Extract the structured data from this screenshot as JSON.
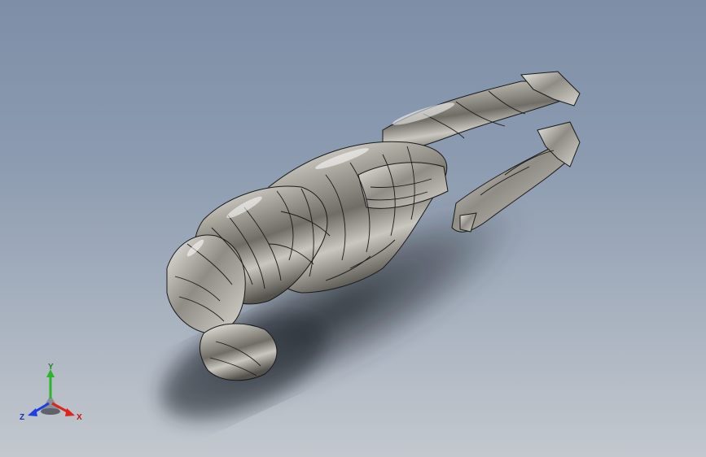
{
  "viewport": {
    "background_top": "#7d8ea7",
    "background_bottom": "#c3c8ce"
  },
  "model": {
    "surface_color": "#b8b6ae",
    "edge_color": "#1a1a1a",
    "shadow_color": "#2a2f36"
  },
  "triad": {
    "x_label": "X",
    "y_label": "Y",
    "z_label": "Z",
    "x_color": "#e0231c",
    "y_color": "#2bb52b",
    "z_color": "#1d3fe0"
  }
}
